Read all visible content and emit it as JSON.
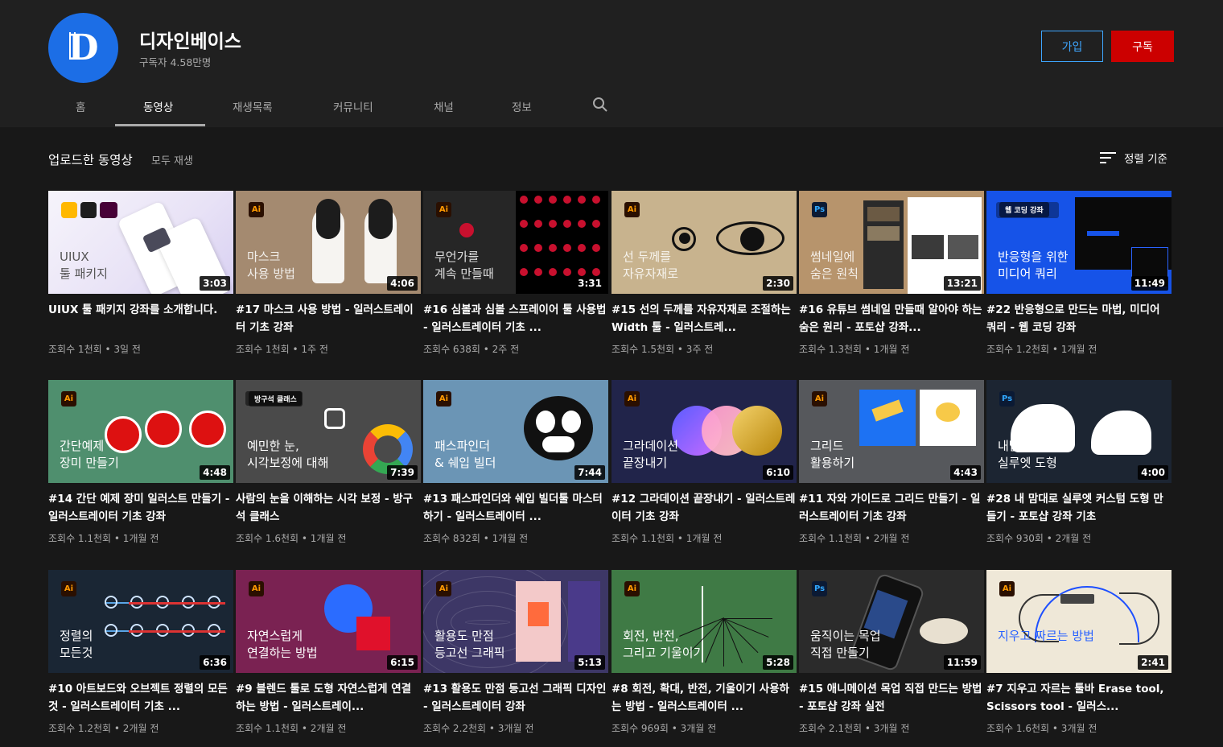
{
  "channel": {
    "name": "디자인베이스",
    "subscribers": "구독자 4.58만명"
  },
  "buttons": {
    "join": "가입",
    "subscribe": "구독"
  },
  "tabs": [
    "홈",
    "동영상",
    "재생목록",
    "커뮤니티",
    "채널",
    "정보"
  ],
  "section": {
    "title": "업로드한 동영상",
    "play_all": "모두 재생",
    "sort": "정렬 기준"
  },
  "colors": {
    "subscribe": "#cc0000",
    "join": "#3ea6ff",
    "avatar": "#1c6ee6"
  },
  "videos": [
    {
      "title": "UIUX 툴 패키지 강좌를 소개합니다.",
      "meta": "조회수 1천회 • 3일 전",
      "duration": "3:03",
      "overlay": "UIUX\n툴 패키지",
      "app": ""
    },
    {
      "title": "#17 마스크 사용 방법 - 일러스트레이터 기초 강좌",
      "meta": "조회수 1천회 • 1주 전",
      "duration": "4:06",
      "overlay": "마스크\n사용 방법",
      "app": "Ai"
    },
    {
      "title": "#16 심볼과 심볼 스프레이어 툴 사용법 - 일러스트레이터 기초 ...",
      "meta": "조회수 638회 • 2주 전",
      "duration": "3:31",
      "overlay": "무언가를\n계속 만들때",
      "app": "Ai"
    },
    {
      "title": "#15 선의 두께를 자유자재로 조절하는 Width 툴 - 일러스트레...",
      "meta": "조회수 1.5천회 • 3주 전",
      "duration": "2:30",
      "overlay": "선 두께를\n자유자재로",
      "app": "Ai"
    },
    {
      "title": "#16 유튜브 썸네일 만들때 알아야 하는 숨은 원리 - 포토샵 강좌...",
      "meta": "조회수 1.3천회 • 1개월 전",
      "duration": "13:21",
      "overlay": "썸네일에\n숨은 원칙",
      "app": "Ps"
    },
    {
      "title": "#22 반응형으로 만드는 마법, 미디어 쿼리 - 웹 코딩 강좌",
      "meta": "조회수 1.2천회 • 1개월 전",
      "duration": "11:49",
      "overlay": "반응형을 위한\n미디어 쿼리",
      "app": "웹 코딩 강좌"
    },
    {
      "title": "#14 간단 예제 장미 일러스트 만들기 - 일러스트레이터 기초 강좌",
      "meta": "조회수 1.1천회 • 1개월 전",
      "duration": "4:48",
      "overlay": "간단예제\n장미 만들기",
      "app": "Ai"
    },
    {
      "title": "사람의 눈을 이해하는 시각 보정 - 방구석 클래스",
      "meta": "조회수 1.6천회 • 1개월 전",
      "duration": "7:39",
      "overlay": "예민한 눈,\n시각보정에 대해",
      "app": "방구석 클래스"
    },
    {
      "title": "#13 패스파인더와 쉐입 빌더툴 마스터하기 - 일러스트레이터 ...",
      "meta": "조회수 832회 • 1개월 전",
      "duration": "7:44",
      "overlay": "패스파인더\n& 쉐입 빌더",
      "app": "Ai"
    },
    {
      "title": "#12 그라데이션 끝장내기 - 일러스트레이터 기초 강좌",
      "meta": "조회수 1.1천회 • 1개월 전",
      "duration": "6:10",
      "overlay": "그라데이션\n끝장내기",
      "app": "Ai"
    },
    {
      "title": "#11 자와 가이드로 그리드 만들기 - 일러스트레이터 기초 강좌",
      "meta": "조회수 1.1천회 • 2개월 전",
      "duration": "4:43",
      "overlay": "그리드\n활용하기",
      "app": "Ai"
    },
    {
      "title": "#28 내 맘대로 실루엣 커스텀 도형 만들기 - 포토샵 강좌 기초",
      "meta": "조회수 930회 • 2개월 전",
      "duration": "4:00",
      "overlay": "내맘대로\n실루엣 도형",
      "app": "Ps"
    },
    {
      "title": "#10 아트보드와 오브젝트 정렬의 모든것 - 일러스트레이터 기초 ...",
      "meta": "조회수 1.2천회 • 2개월 전",
      "duration": "6:36",
      "overlay": "정렬의\n모든것",
      "app": "Ai"
    },
    {
      "title": "#9 블렌드 툴로 도형 자연스럽게 연결하는 방법 - 일러스트레이...",
      "meta": "조회수 1.1천회 • 2개월 전",
      "duration": "6:15",
      "overlay": "자연스럽게\n연결하는 방법",
      "app": "Ai"
    },
    {
      "title": "#13 활용도 만점 등고선 그래픽 디자인 - 일러스트레이터 강좌",
      "meta": "조회수 2.2천회 • 3개월 전",
      "duration": "5:13",
      "overlay": "활용도 만점\n등고선 그래픽",
      "app": "Ai"
    },
    {
      "title": "#8 회전, 확대, 반전, 기울이기 사용하는 방법 - 일러스트레이터 ...",
      "meta": "조회수 969회 • 3개월 전",
      "duration": "5:28",
      "overlay": "회전, 반전,\n그리고 기울이기",
      "app": "Ai"
    },
    {
      "title": "#15 애니메이션 목업 직접 만드는 방법 - 포토샵 강좌 실전",
      "meta": "조회수 2.1천회 • 3개월 전",
      "duration": "11:59",
      "overlay": "움직이는 목업\n직접 만들기",
      "app": "Ps"
    },
    {
      "title": "#7 지우고 자르는 툴바 Erase tool, Scissors tool - 일러스...",
      "meta": "조회수 1.6천회 • 3개월 전",
      "duration": "2:41",
      "overlay": "지우고 짜르는 방법",
      "app": "Ai"
    }
  ]
}
